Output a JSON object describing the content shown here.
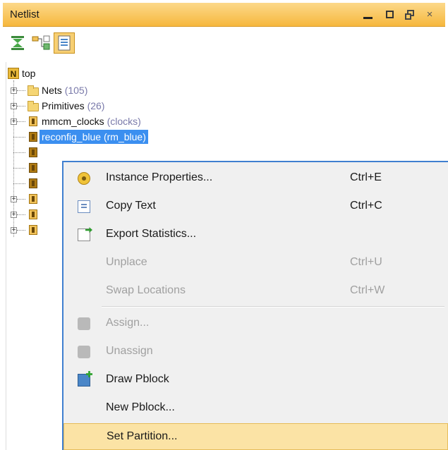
{
  "window": {
    "title": "Netlist",
    "controls": {
      "minimize": "minimize-icon",
      "maximize": "maximize-icon",
      "restore": "restore-icon",
      "close": "×"
    }
  },
  "toolbar": {
    "buttons": [
      {
        "icon": "collapse-all-icon"
      },
      {
        "icon": "expand-all-icon"
      },
      {
        "icon": "show-hierarchy-icon",
        "active": true
      }
    ]
  },
  "tree": {
    "root": "top",
    "items": [
      {
        "label": "Nets",
        "count": "(105)"
      },
      {
        "label": "Primitives",
        "count": "(26)"
      },
      {
        "label": "mmcm_clocks",
        "count": "(clocks)"
      },
      {
        "label": "reconfig_blue (rm_blue)",
        "selected": true
      }
    ]
  },
  "context_menu": {
    "items": [
      {
        "label": "Instance Properties...",
        "shortcut": "Ctrl+E",
        "icon": "properties-icon",
        "enabled": true
      },
      {
        "label": "Copy Text",
        "shortcut": "Ctrl+C",
        "icon": "copy-icon",
        "enabled": true
      },
      {
        "label": "Export Statistics...",
        "shortcut": "",
        "icon": "export-icon",
        "enabled": true
      },
      {
        "label": "Unplace",
        "shortcut": "Ctrl+U",
        "icon": "",
        "enabled": false
      },
      {
        "label": "Swap Locations",
        "shortcut": "Ctrl+W",
        "icon": "",
        "enabled": false
      },
      {
        "label": "Assign...",
        "shortcut": "",
        "icon": "assign-icon",
        "enabled": false
      },
      {
        "label": "Unassign",
        "shortcut": "",
        "icon": "unassign-icon",
        "enabled": false
      },
      {
        "label": "Draw Pblock",
        "shortcut": "",
        "icon": "draw-pblock-icon",
        "enabled": true
      },
      {
        "label": "New Pblock...",
        "shortcut": "",
        "icon": "",
        "enabled": true
      },
      {
        "label": "Set Partition...",
        "shortcut": "",
        "icon": "",
        "enabled": true,
        "highlighted": true
      }
    ]
  },
  "colors": {
    "titlebar": "#f6b73d",
    "selection": "#3b8ff0",
    "menu_background": "#f0f0f0",
    "menu_highlight": "#fbe3a5",
    "disabled_text": "#a0a0a0"
  }
}
